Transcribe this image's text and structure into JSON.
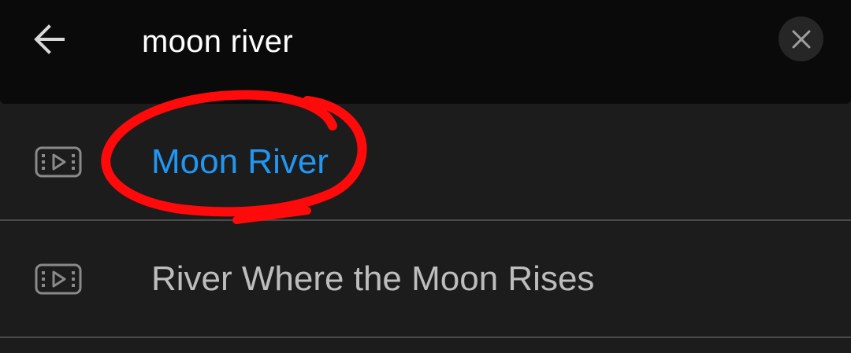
{
  "search": {
    "query": "moon river"
  },
  "icons": {
    "back": "arrow-back-icon",
    "clear": "close-icon",
    "result": "video-icon"
  },
  "results": [
    {
      "label": "Moon River",
      "highlighted": true
    },
    {
      "label": "River Where the Moon Rises",
      "highlighted": false
    }
  ],
  "colors": {
    "highlight": "#2196f3",
    "annotation": "#ff0a0a"
  }
}
